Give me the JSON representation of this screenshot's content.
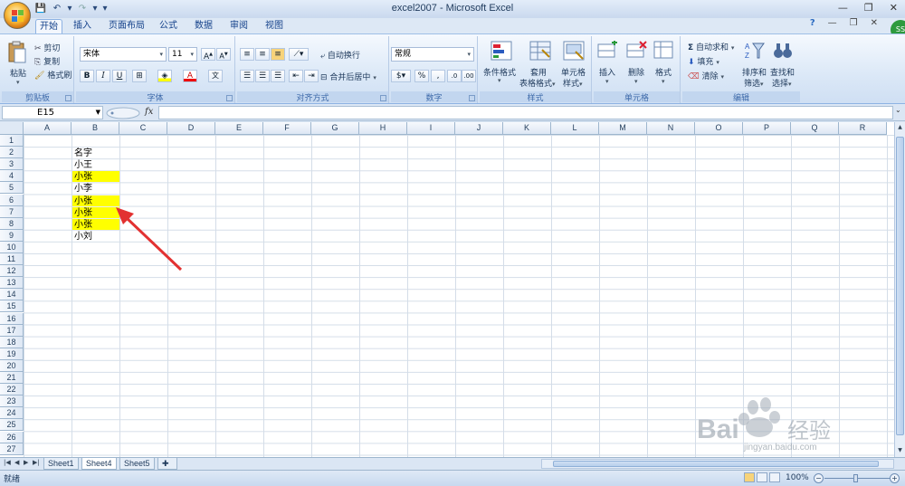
{
  "window": {
    "title": "excel2007 - Microsoft Excel"
  },
  "tabs": [
    {
      "label": "开始",
      "active": true
    },
    {
      "label": "插入"
    },
    {
      "label": "页面布局"
    },
    {
      "label": "公式"
    },
    {
      "label": "数据"
    },
    {
      "label": "审阅"
    },
    {
      "label": "视图"
    }
  ],
  "user_initials": "SS",
  "ribbon": {
    "clipboard": {
      "paste": "粘贴",
      "cut": "剪切",
      "copy": "复制",
      "format_painter": "格式刷",
      "label": "剪贴板"
    },
    "font": {
      "name": "宋体",
      "size": "11",
      "bold": "B",
      "italic": "I",
      "underline": "U",
      "label": "字体"
    },
    "alignment": {
      "wrap": "自动换行",
      "merge": "合并后居中",
      "label": "对齐方式"
    },
    "number": {
      "format": "常规",
      "percent": "%",
      "comma": ",",
      "label": "数字"
    },
    "styles": {
      "conditional_1": "条件格式",
      "table_1": "套用",
      "table_2": "表格格式",
      "cell_1": "单元格",
      "cell_2": "样式",
      "label": "样式"
    },
    "cells": {
      "insert": "插入",
      "delete": "删除",
      "format": "格式",
      "label": "单元格"
    },
    "editing": {
      "autosum": "自动求和",
      "fill": "填充",
      "clear": "清除",
      "sort_1": "排序和",
      "sort_2": "筛选",
      "find_1": "查找和",
      "find_2": "选择",
      "label": "编辑"
    }
  },
  "formula_bar": {
    "name_box": "E15",
    "fx": "fx",
    "formula": ""
  },
  "grid": {
    "columns": [
      "A",
      "B",
      "C",
      "D",
      "E",
      "F",
      "G",
      "H",
      "I",
      "J",
      "K",
      "L",
      "M",
      "N",
      "O",
      "P",
      "Q",
      "R"
    ],
    "rows": [
      "1",
      "2",
      "3",
      "4",
      "5",
      "6",
      "7",
      "8",
      "9",
      "10",
      "11",
      "12",
      "13",
      "14",
      "15",
      "16",
      "17",
      "18",
      "19",
      "20",
      "21",
      "22",
      "23",
      "24",
      "25",
      "26",
      "27"
    ],
    "cells": [
      {
        "ref": "B2",
        "value": "名字",
        "highlight": false
      },
      {
        "ref": "B3",
        "value": "小王",
        "highlight": false
      },
      {
        "ref": "B4",
        "value": "小张",
        "highlight": true
      },
      {
        "ref": "B5",
        "value": "小李",
        "highlight": false
      },
      {
        "ref": "B6",
        "value": "小张",
        "highlight": true
      },
      {
        "ref": "B7",
        "value": "小张",
        "highlight": true
      },
      {
        "ref": "B8",
        "value": "小张",
        "highlight": true
      },
      {
        "ref": "B9",
        "value": "小刘",
        "highlight": false
      }
    ],
    "highlight_color": "#ffff00"
  },
  "annotation": {
    "color": "#e23131"
  },
  "sheets": [
    {
      "label": "Sheet1"
    },
    {
      "label": "Sheet4",
      "active": true
    },
    {
      "label": "Sheet5"
    }
  ],
  "status": {
    "ready": "就绪",
    "zoom": "100%"
  },
  "watermark": {
    "brand": "Bai du 经验",
    "url": "jingyan.baidu.com"
  }
}
